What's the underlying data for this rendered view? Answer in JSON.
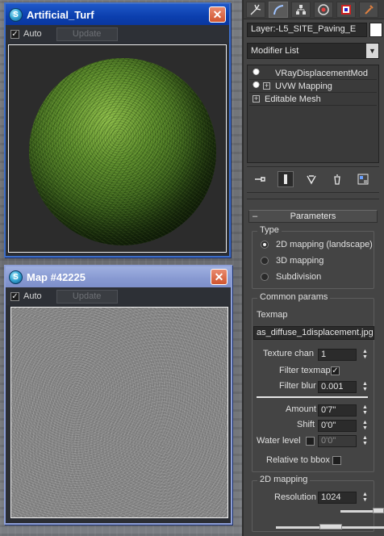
{
  "material_window": {
    "title": "Artificial_Turf",
    "auto_label": "Auto",
    "auto_checked": true,
    "update_label": "Update",
    "close_glyph": "✕"
  },
  "map_window": {
    "title": "Map #42225",
    "auto_label": "Auto",
    "auto_checked": true,
    "update_label": "Update",
    "close_glyph": "✕"
  },
  "command_panel": {
    "tabs": [
      {
        "icon": "create-icon"
      },
      {
        "icon": "modify-icon"
      },
      {
        "icon": "hierarchy-icon"
      },
      {
        "icon": "motion-icon"
      },
      {
        "icon": "display-icon"
      },
      {
        "icon": "utilities-icon"
      }
    ],
    "object_name": "Layer:-L5_SITE_Paving_E",
    "object_color": "#ffffff",
    "modifier_list": "Modifier List",
    "stack": [
      {
        "label": "VRayDisplacementMod",
        "bulb": true,
        "expandable": false
      },
      {
        "label": "UVW Mapping",
        "bulb": true,
        "expandable": true
      },
      {
        "label": "Editable Mesh",
        "bulb": false,
        "expandable": true
      }
    ],
    "parameters": {
      "title": "Parameters",
      "type_group": "Type",
      "type_options": [
        {
          "label": "2D mapping (landscape)",
          "selected": true
        },
        {
          "label": "3D mapping",
          "selected": false
        },
        {
          "label": "Subdivision",
          "selected": false
        }
      ],
      "common_group": "Common params",
      "texmap_label": "Texmap",
      "texmap_value": "as_diffuse_1displacement.jpg)",
      "texture_chan_label": "Texture chan",
      "texture_chan_value": "1",
      "filter_texmap_label": "Filter texmap",
      "filter_texmap_checked": true,
      "filter_blur_label": "Filter blur",
      "filter_blur_value": "0.001",
      "amount_label": "Amount",
      "amount_value": "0'7\"",
      "shift_label": "Shift",
      "shift_value": "0'0\"",
      "water_level_label": "Water level",
      "water_level_checked": false,
      "water_level_value": "0'0\"",
      "relative_bbox_label": "Relative to bbox",
      "relative_bbox_checked": false,
      "mapping2d_group": "2D mapping",
      "resolution_label": "Resolution",
      "resolution_value": "1024"
    }
  }
}
